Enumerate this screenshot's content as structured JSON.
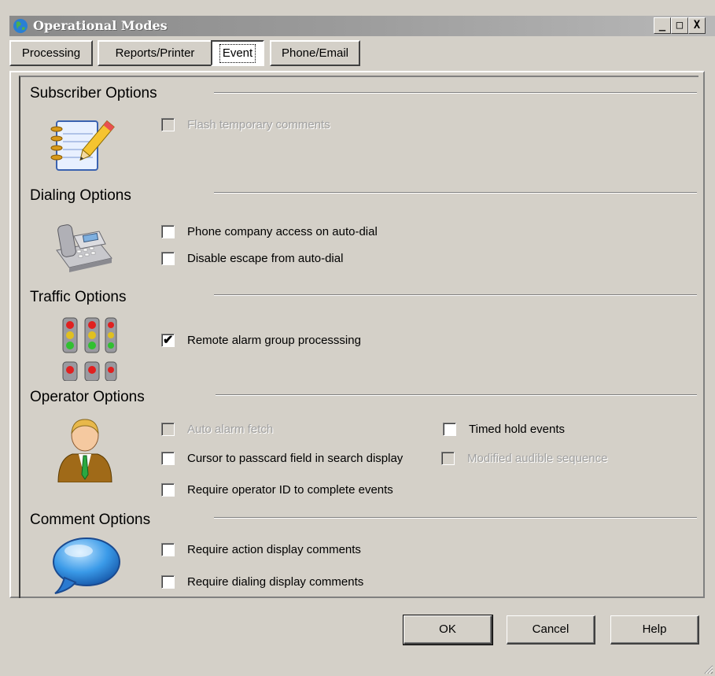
{
  "window": {
    "title": "Operational Modes",
    "minimize_label": "_",
    "maximize_label": "□",
    "close_label": "X"
  },
  "tabs": [
    {
      "label": "Processing"
    },
    {
      "label": "Reports/Printer"
    },
    {
      "label": "Event",
      "active": true
    },
    {
      "label": "Phone/Email"
    }
  ],
  "sections": {
    "subscriber": {
      "title": "Subscriber Options",
      "icon": "notepad-pencil-icon",
      "options": [
        {
          "label": "Flash temporary comments",
          "checked": false,
          "enabled": false
        }
      ]
    },
    "dialing": {
      "title": "Dialing Options",
      "icon": "telephone-icon",
      "options": [
        {
          "label": "Phone company access on auto-dial",
          "checked": false,
          "enabled": true
        },
        {
          "label": "Disable escape from auto-dial",
          "checked": false,
          "enabled": true
        }
      ]
    },
    "traffic": {
      "title": "Traffic Options",
      "icon": "traffic-lights-icon",
      "options": [
        {
          "label": "Remote alarm group processsing",
          "checked": true,
          "enabled": true
        }
      ]
    },
    "operator": {
      "title": "Operator Options",
      "icon": "operator-person-icon",
      "options": [
        {
          "label": "Auto alarm fetch",
          "checked": false,
          "enabled": false
        },
        {
          "label": "Timed hold events",
          "checked": false,
          "enabled": true
        },
        {
          "label": "Cursor to passcard field in search display",
          "checked": false,
          "enabled": true
        },
        {
          "label": "Modified audible sequence",
          "checked": false,
          "enabled": false
        },
        {
          "label": "Require operator ID to complete events",
          "checked": false,
          "enabled": true
        }
      ]
    },
    "comment": {
      "title": "Comment Options",
      "icon": "speech-bubble-icon",
      "options": [
        {
          "label": "Require action display comments",
          "checked": false,
          "enabled": true
        },
        {
          "label": "Require dialing display comments",
          "checked": false,
          "enabled": true
        }
      ]
    }
  },
  "buttons": {
    "ok": "OK",
    "cancel": "Cancel",
    "help": "Help"
  },
  "check_mark": "✔"
}
